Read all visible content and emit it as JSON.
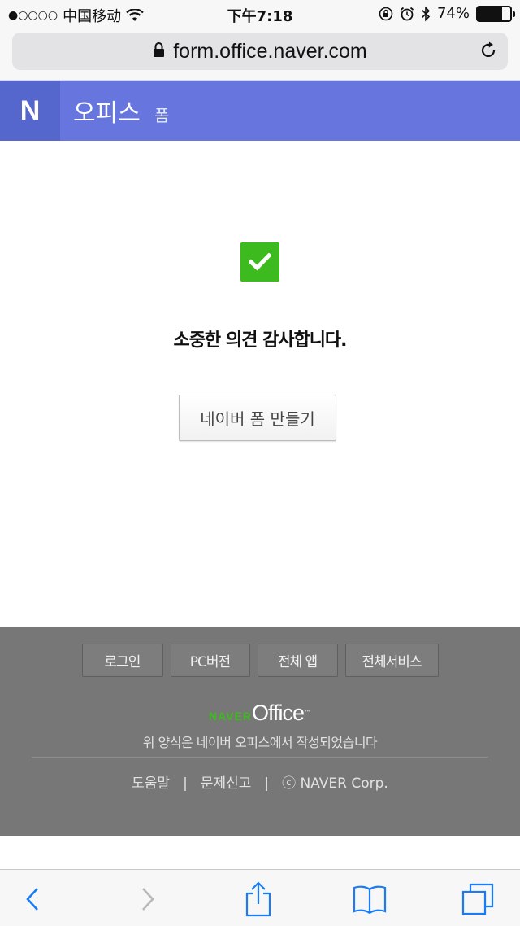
{
  "status_bar": {
    "signal": "●○○○○",
    "carrier": "中国移动",
    "time": "下午7:18",
    "battery_text": "74%",
    "battery_level": 0.74
  },
  "browser": {
    "url": "form.office.naver.com"
  },
  "header": {
    "logo_letter": "N",
    "title": "오피스",
    "subtitle": "폼"
  },
  "main": {
    "message": "소중한 의견 감사합니다.",
    "create_button_label": "네이버 폼 만들기"
  },
  "footer": {
    "buttons": [
      "로그인",
      "PC버전",
      "전체 앱",
      "전체서비스"
    ],
    "brand_naver": "NAVER",
    "brand_office": "Office",
    "brand_tm": "™",
    "description": "위 양식은 네이버 오피스에서 작성되었습니다",
    "links": {
      "help": "도움말",
      "report": "문제신고",
      "copyright": "ⓒ NAVER Corp.",
      "separator": "|"
    }
  },
  "colors": {
    "header_bg": "#6676de",
    "logo_bg": "#5566cc",
    "check_green": "#3dbb1e",
    "footer_bg": "#777777",
    "ios_blue": "#1a7cf5"
  }
}
